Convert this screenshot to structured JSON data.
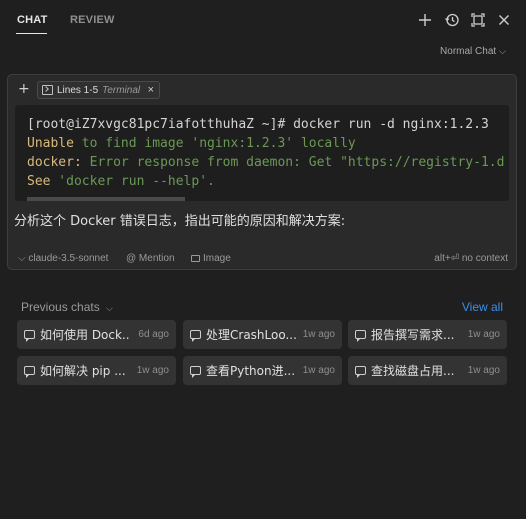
{
  "header": {
    "tabs": [
      {
        "label": "CHAT",
        "active": true
      },
      {
        "label": "REVIEW",
        "active": false
      }
    ],
    "icons": [
      "plus-icon",
      "history-icon",
      "maximize-icon",
      "close-icon"
    ]
  },
  "mode": {
    "label": "Normal Chat",
    "chevron": "⌵"
  },
  "composer": {
    "add_icon": "+",
    "chip": {
      "label": "Lines 1-5",
      "kind": "Terminal",
      "close": "×"
    },
    "terminal": {
      "line1": "[root@iZ7xvgc81pc7iafotthuhaZ ~]# docker run -d nginx:1.2.3",
      "line2_kw": "Unable",
      "line2_msg": " to find image 'nginx:1.2.3' locally",
      "line3_kw": "docker:",
      "line3_msg": " Error response from daemon: Get \"https://registry-1.d",
      "line4_kw": "See",
      "line4_msg": " 'docker run --help'."
    },
    "prompt": "分析这个 Docker 错误日志，指出可能的原因和解决方案:",
    "footer": {
      "model": "⌵ claude-3.5-sonnet",
      "mention": "@ Mention",
      "image": "Image",
      "context": "alt+⏎ no context"
    }
  },
  "previous": {
    "title": "Previous chats",
    "chevron": "⌵",
    "view_all": "View all",
    "chats": [
      {
        "title": "如何使用 Dock...",
        "time": "6d ago"
      },
      {
        "title": "处理CrashLoo...",
        "time": "1w ago"
      },
      {
        "title": "报告撰写需求...",
        "time": "1w ago"
      },
      {
        "title": "如何解决 pip ...",
        "time": "1w ago"
      },
      {
        "title": "查看Python进...",
        "time": "1w ago"
      },
      {
        "title": "查找磁盘占用...",
        "time": "1w ago"
      }
    ]
  },
  "colors": {
    "background": "#1f1f1f",
    "composer_bg": "#2a2a2a",
    "terminal_bg": "#1e1e1e",
    "keyword": "#d7ba7d",
    "message": "#6a9955",
    "link": "#3b8eea"
  }
}
